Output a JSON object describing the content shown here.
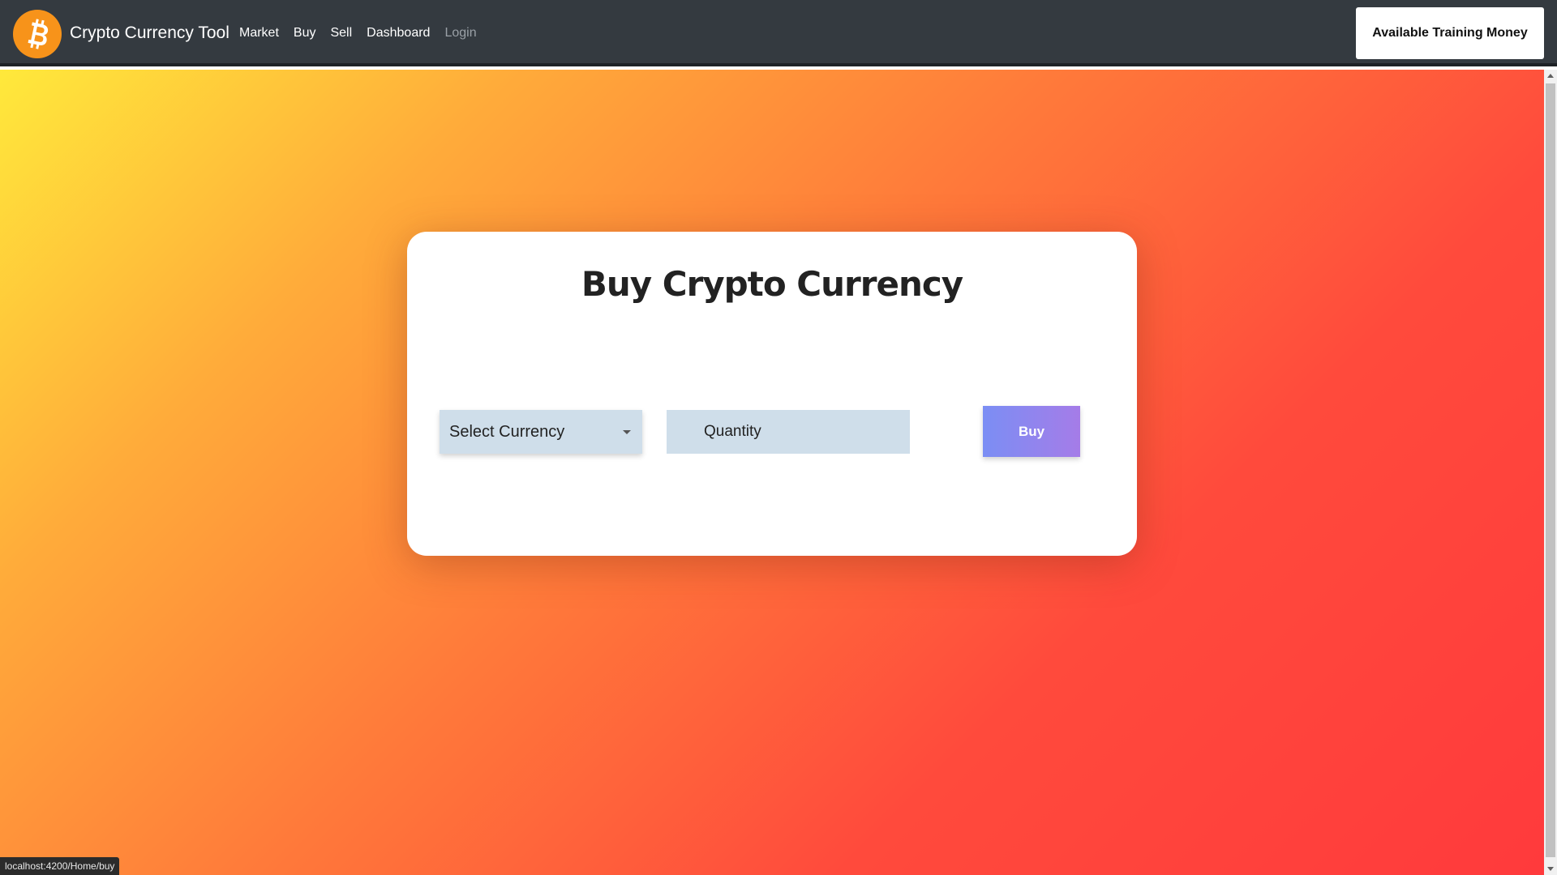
{
  "navbar": {
    "brand": "Crypto Currency Tool",
    "logo_icon": "bitcoin-logo-icon",
    "links": [
      "Market",
      "Buy",
      "Sell",
      "Dashboard",
      "Login"
    ],
    "money_button": "Available Training Money"
  },
  "card": {
    "title": "Buy Crypto Currency",
    "select_value": "Select Currency",
    "quantity_placeholder": "Quantity",
    "buy_label": "Buy"
  },
  "status_url": "localhost:4200/Home/buy",
  "colors": {
    "navbar": "#343a40",
    "logo": "#f7931a",
    "input_bg": "#cfdeea",
    "button_gradient_start": "#7b8ef4",
    "button_gradient_end": "#a57ce8"
  }
}
